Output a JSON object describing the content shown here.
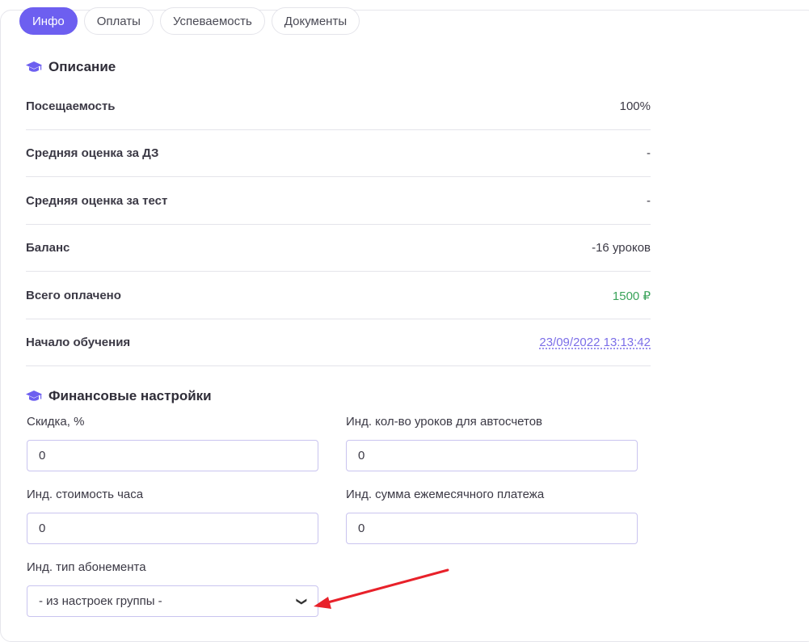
{
  "tabs": [
    "Инфо",
    "Оплаты",
    "Успеваемость",
    "Документы"
  ],
  "description": {
    "title": "Описание",
    "rows": [
      {
        "label": "Посещаемость",
        "value": "100%"
      },
      {
        "label": "Средняя оценка за ДЗ",
        "value": "-"
      },
      {
        "label": "Средняя оценка за тест",
        "value": "-"
      },
      {
        "label": "Баланс",
        "value": "-16 уроков"
      },
      {
        "label": "Всего оплачено",
        "value": "1500 ₽"
      },
      {
        "label": "Начало обучения",
        "value": "23/09/2022 13:13:42"
      }
    ]
  },
  "finance": {
    "title": "Финансовые настройки",
    "discount": {
      "label": "Скидка, %",
      "value": "0"
    },
    "lessons_autobill": {
      "label": "Инд. кол-во уроков для автосчетов",
      "value": "0"
    },
    "hour_price": {
      "label": "Инд. стоимость часа",
      "value": "0"
    },
    "monthly_sum": {
      "label": "Инд. сумма ежемесячного платежа",
      "value": "0"
    },
    "subscription_type": {
      "label": "Инд. тип абонемента",
      "value": "- из настроек группы -"
    }
  },
  "colors": {
    "accent": "#6d5ff0",
    "paid": "#3aa35a",
    "arrow": "#e8212a"
  }
}
